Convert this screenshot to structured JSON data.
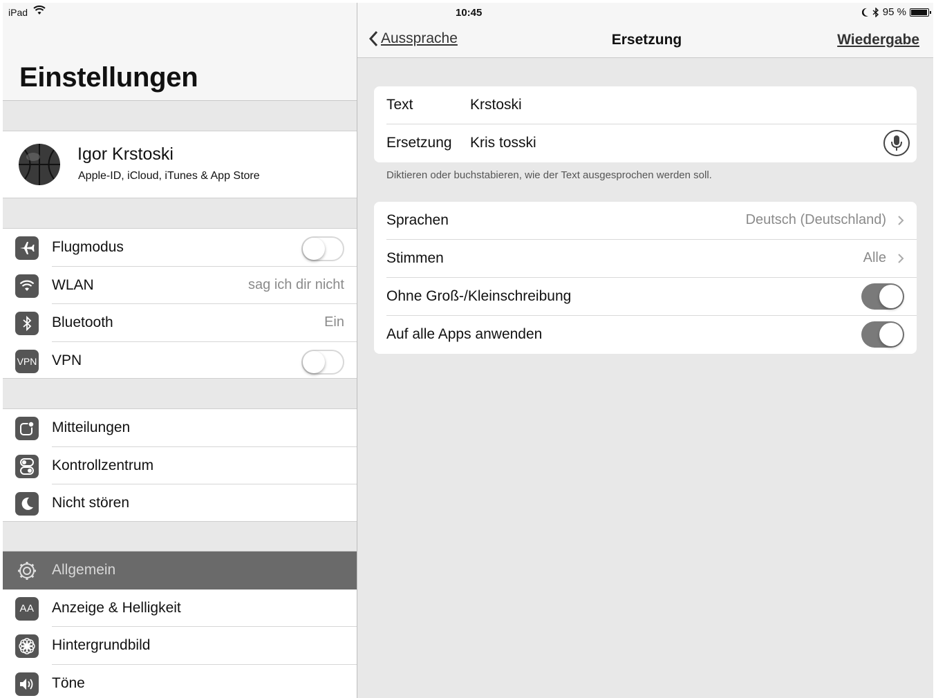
{
  "status_bar": {
    "device": "iPad",
    "time": "10:45",
    "battery": "95 %",
    "battery_level": 0.95
  },
  "sidebar": {
    "title": "Einstellungen",
    "profile": {
      "name": "Igor Krstoski",
      "subtitle": "Apple-ID, iCloud, iTunes & App Store"
    },
    "network": [
      {
        "label": "Flugmodus",
        "icon": "airplane-icon",
        "toggle": false
      },
      {
        "label": "WLAN",
        "icon": "wifi-icon",
        "value": "sag ich dir nicht"
      },
      {
        "label": "Bluetooth",
        "icon": "bluetooth-icon",
        "value": "Ein"
      },
      {
        "label": "VPN",
        "icon": "vpn-icon",
        "icon_text": "VPN",
        "toggle": false
      }
    ],
    "notifications": [
      {
        "label": "Mitteilungen",
        "icon": "notifications-icon"
      },
      {
        "label": "Kontrollzentrum",
        "icon": "control-center-icon"
      },
      {
        "label": "Nicht stören",
        "icon": "moon-icon"
      }
    ],
    "general": [
      {
        "label": "Allgemein",
        "icon": "gear-icon",
        "selected": true
      },
      {
        "label": "Anzeige & Helligkeit",
        "icon": "display-icon",
        "icon_text": "AA"
      },
      {
        "label": "Hintergrundbild",
        "icon": "wallpaper-icon"
      },
      {
        "label": "Töne",
        "icon": "speaker-icon"
      }
    ]
  },
  "nav": {
    "back_label": "Aussprache",
    "title": "Ersetzung",
    "action_label": "Wiedergabe"
  },
  "form": {
    "text_label": "Text",
    "text_value": "Krstoski",
    "replacement_label": "Ersetzung",
    "replacement_value": "Kris tosski",
    "hint": "Diktieren oder buchstabieren, wie der Text ausgesprochen werden soll."
  },
  "options": [
    {
      "label": "Sprachen",
      "value": "Deutsch (Deutschland)",
      "type": "disclosure"
    },
    {
      "label": "Stimmen",
      "value": "Alle",
      "type": "disclosure"
    },
    {
      "label": "Ohne Groß-/Kleinschreibung",
      "type": "toggle",
      "on": true
    },
    {
      "label": "Auf alle Apps anwenden",
      "type": "toggle",
      "on": true
    }
  ],
  "colors": {
    "background": "#e8e8e8",
    "selected_row": "#6a6a6a",
    "toggle_on": "#7a7a7a"
  }
}
